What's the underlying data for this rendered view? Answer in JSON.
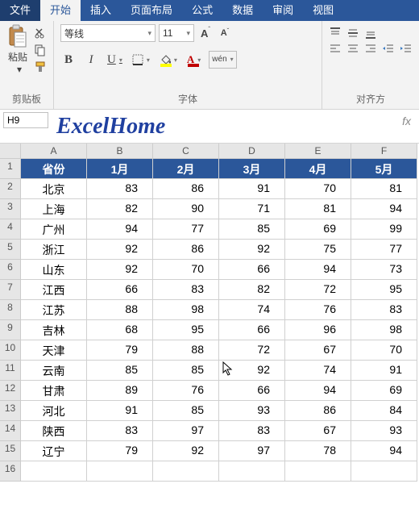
{
  "menu": {
    "file": "文件",
    "home": "开始",
    "insert": "插入",
    "layout": "页面布局",
    "formula": "公式",
    "data": "数据",
    "review": "审阅",
    "view": "视图"
  },
  "ribbon": {
    "clipboard": {
      "paste": "粘贴",
      "group": "剪贴板"
    },
    "font": {
      "name": "等线",
      "size": "11",
      "group": "字体",
      "bold": "B",
      "italic": "I",
      "underline": "U",
      "wen": "wén"
    },
    "align": {
      "group": "对齐方"
    }
  },
  "namebox": "H9",
  "watermark": "ExcelHome",
  "fx": "fx",
  "columns": [
    "A",
    "B",
    "C",
    "D",
    "E",
    "F"
  ],
  "headers": [
    "省份",
    "1月",
    "2月",
    "3月",
    "4月",
    "5月"
  ],
  "rows": [
    {
      "n": 1
    },
    {
      "n": 2,
      "p": "北京",
      "v": [
        83,
        86,
        91,
        70,
        81
      ]
    },
    {
      "n": 3,
      "p": "上海",
      "v": [
        82,
        90,
        71,
        81,
        94
      ]
    },
    {
      "n": 4,
      "p": "广州",
      "v": [
        94,
        77,
        85,
        69,
        99
      ]
    },
    {
      "n": 5,
      "p": "浙江",
      "v": [
        92,
        86,
        92,
        75,
        77
      ]
    },
    {
      "n": 6,
      "p": "山东",
      "v": [
        92,
        70,
        66,
        94,
        73
      ]
    },
    {
      "n": 7,
      "p": "江西",
      "v": [
        66,
        83,
        82,
        72,
        95
      ]
    },
    {
      "n": 8,
      "p": "江苏",
      "v": [
        88,
        98,
        74,
        76,
        83
      ]
    },
    {
      "n": 9,
      "p": "吉林",
      "v": [
        68,
        95,
        66,
        96,
        98
      ]
    },
    {
      "n": 10,
      "p": "天津",
      "v": [
        79,
        88,
        72,
        67,
        70
      ]
    },
    {
      "n": 11,
      "p": "云南",
      "v": [
        85,
        85,
        92,
        74,
        91
      ]
    },
    {
      "n": 12,
      "p": "甘肃",
      "v": [
        89,
        76,
        66,
        94,
        69
      ]
    },
    {
      "n": 13,
      "p": "河北",
      "v": [
        91,
        85,
        93,
        86,
        84
      ]
    },
    {
      "n": 14,
      "p": "陕西",
      "v": [
        83,
        97,
        83,
        67,
        93
      ]
    },
    {
      "n": 15,
      "p": "辽宁",
      "v": [
        79,
        92,
        97,
        78,
        94
      ]
    }
  ],
  "colors": {
    "ribbon_blue": "#2b579a",
    "fill_yellow": "#ffff00",
    "font_red": "#c00000"
  }
}
